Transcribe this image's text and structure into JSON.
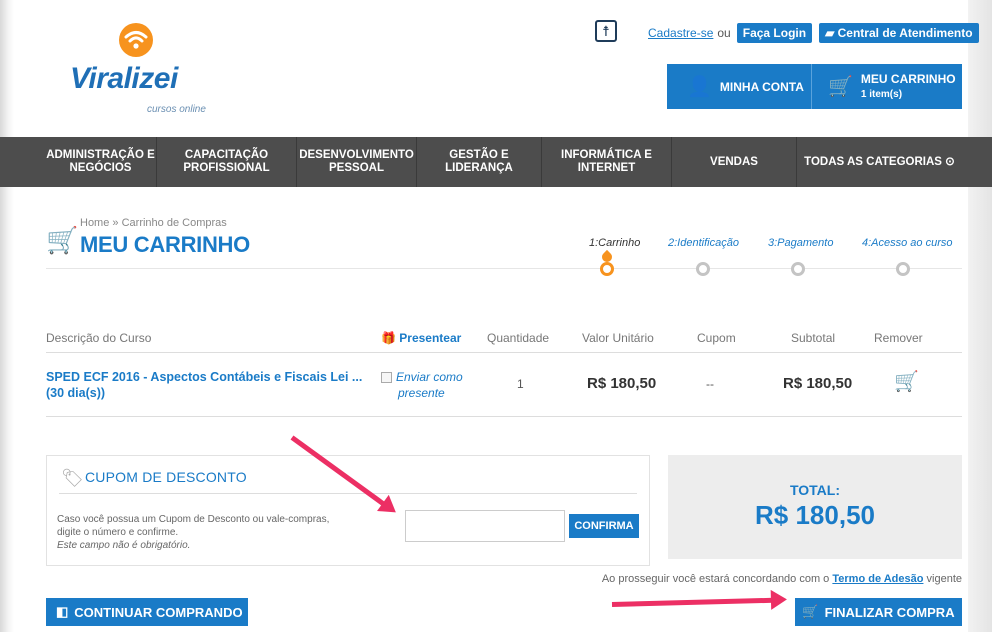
{
  "brand": {
    "logo_text": "Viralizei",
    "logo_sub": "cursos online",
    "accent": "#1a7bc7",
    "orange": "#f7931e"
  },
  "header": {
    "accessibility_icon": "accessibility-icon",
    "signup": "Cadastre-se",
    "or": "ou",
    "login": "Faça Login",
    "support": "Central de Atendimento",
    "account": "MINHA CONTA",
    "cart": "MEU CARRINHO",
    "cart_count": "1 item(s)"
  },
  "nav": [
    "ADMINISTRAÇÃO E NEGÓCIOS",
    "CAPACITAÇÃO PROFISSIONAL",
    "DESENVOLVIMENTO PESSOAL",
    "GESTÃO E LIDERANÇA",
    "INFORMÁTICA E INTERNET",
    "VENDAS",
    "TODAS AS CATEGORIAS ⊙"
  ],
  "breadcrumb": {
    "home": "Home",
    "sep": "»",
    "current": "Carrinho de Compras"
  },
  "page_title": "MEU CARRINHO",
  "steps": [
    "1:Carrinho",
    "2:Identificação",
    "3:Pagamento",
    "4:Acesso ao curso"
  ],
  "table": {
    "headers": {
      "description": "Descrição do Curso",
      "gift": "Presentear",
      "quantity": "Quantidade",
      "unit_price": "Valor Unitário",
      "coupon": "Cupom",
      "subtotal": "Subtotal",
      "remove": "Remover"
    },
    "rows": [
      {
        "course": "SPED ECF 2016 - Aspectos Contábeis e Fiscais Lei ... (30 dia(s))",
        "gift_line1": "Enviar como",
        "gift_line2": "presente",
        "quantity": "1",
        "unit_price": "R$ 180,50",
        "coupon": "--",
        "subtotal": "R$ 180,50"
      }
    ]
  },
  "coupon": {
    "title": "CUPOM DE DESCONTO",
    "desc_line1": "Caso você possua um Cupom de Desconto ou vale-compras,",
    "desc_line2": "digite o número e confirme.",
    "desc_line3": "Este campo não é obrigatório.",
    "input_value": "",
    "confirm": "CONFIRMA"
  },
  "total": {
    "label": "TOTAL:",
    "value": "R$ 180,50"
  },
  "terms": {
    "prefix": "Ao prosseguir você estará concordando com o",
    "link": "Termo de Adesão",
    "suffix": "vigente"
  },
  "actions": {
    "continue": "CONTINUAR COMPRANDO",
    "finish": "FINALIZAR COMPRA"
  }
}
